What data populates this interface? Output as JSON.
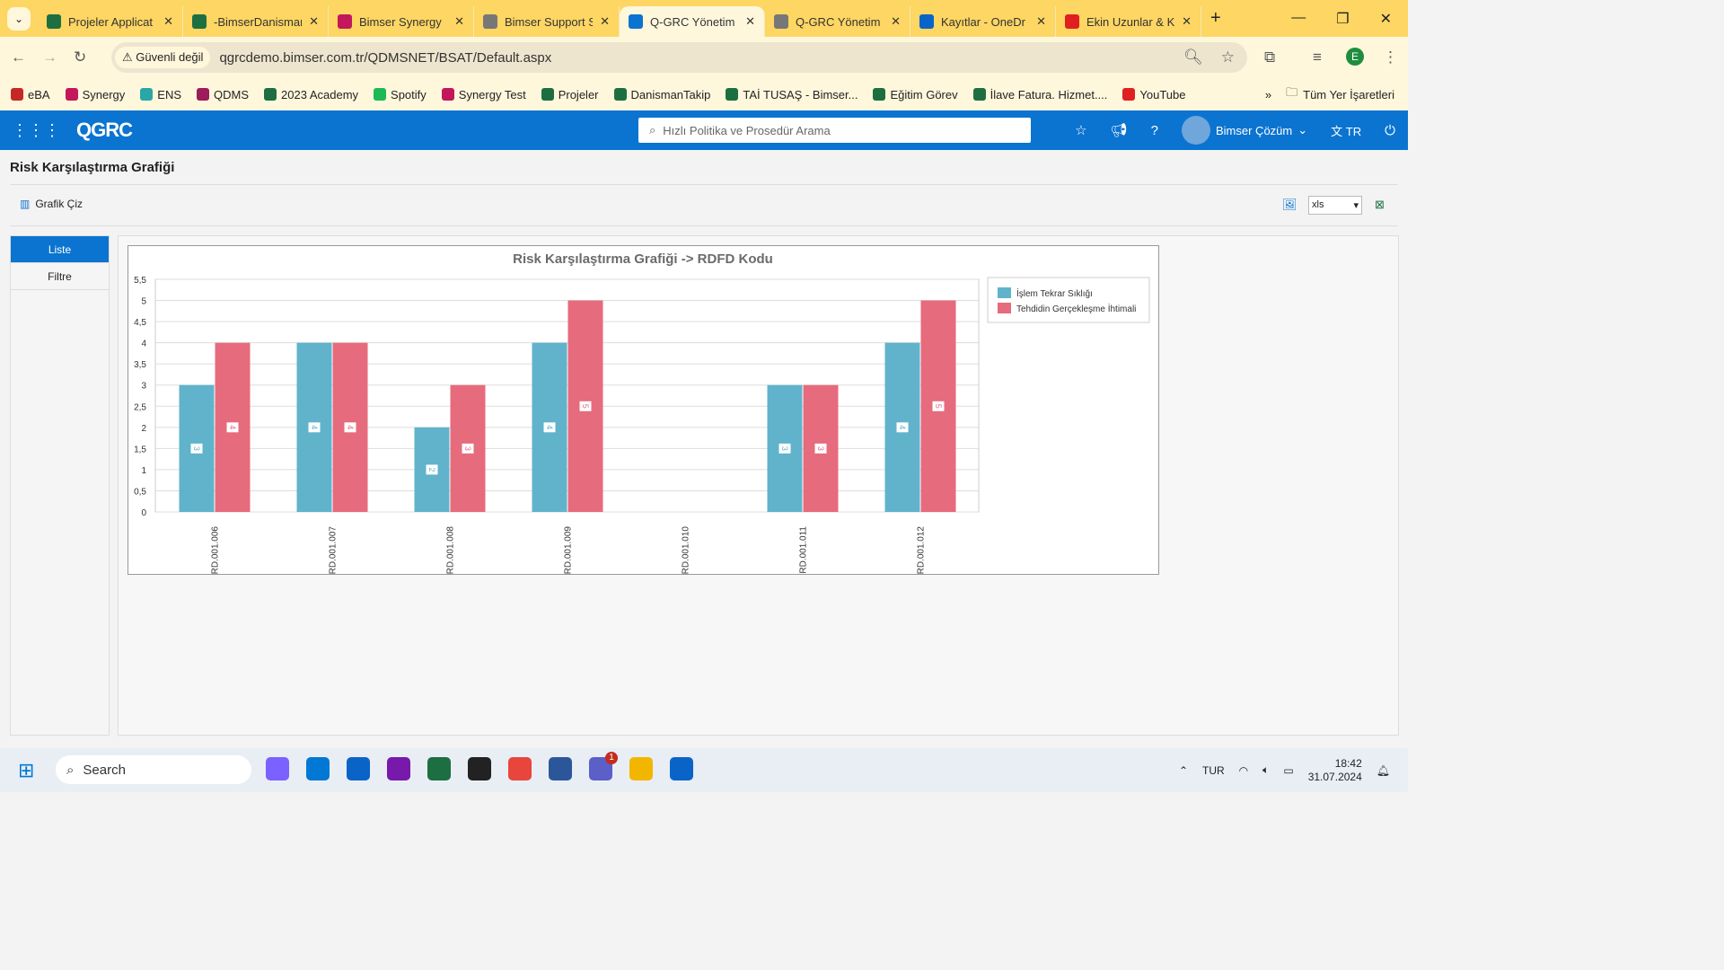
{
  "browser": {
    "tabs": [
      {
        "title": "Projeler Applicat",
        "icon": "excel-icon",
        "color": "#1d6f42"
      },
      {
        "title": "-BimserDanisman",
        "icon": "excel-icon",
        "color": "#1d6f42"
      },
      {
        "title": "Bimser Synergy",
        "icon": "synergy-icon",
        "color": "#c2185b"
      },
      {
        "title": "Bimser Support S",
        "icon": "globe-icon",
        "color": "#777777"
      },
      {
        "title": "Q-GRC Yönetim S",
        "icon": "grc-icon",
        "color": "#0b74d0",
        "active": true
      },
      {
        "title": "Q-GRC Yönetim",
        "icon": "globe-icon",
        "color": "#777777"
      },
      {
        "title": "Kayıtlar - OneDr",
        "icon": "onedrive-icon",
        "color": "#0a64c8"
      },
      {
        "title": "Ekin Uzunlar & K",
        "icon": "youtube-icon",
        "color": "#e02020"
      }
    ],
    "security_label": "Güvenli değil",
    "url": "qgrcdemo.bimser.com.tr/QDMSNET/BSAT/Default.aspx",
    "profile_initial": "E",
    "bookmarks": [
      {
        "label": "eBA",
        "color": "#c62828"
      },
      {
        "label": "Synergy",
        "color": "#c2185b"
      },
      {
        "label": "ENS",
        "color": "#2aa6a6"
      },
      {
        "label": "QDMS",
        "color": "#9c1c5c"
      },
      {
        "label": "2023 Academy",
        "color": "#1d6f42"
      },
      {
        "label": "Spotify",
        "color": "#1db954"
      },
      {
        "label": "Synergy Test",
        "color": "#c2185b"
      },
      {
        "label": "Projeler",
        "color": "#1d6f42"
      },
      {
        "label": "DanismanTakip",
        "color": "#1d6f42"
      },
      {
        "label": "TAİ TUSAŞ - Bimser...",
        "color": "#1d6f42"
      },
      {
        "label": "Eğitim Görev",
        "color": "#1d6f42"
      },
      {
        "label": "İlave Fatura. Hizmet....",
        "color": "#1d6f42"
      },
      {
        "label": "YouTube",
        "color": "#e02020"
      }
    ],
    "all_bookmarks": "Tüm Yer İşaretleri"
  },
  "app": {
    "logo": "QGRC",
    "search_placeholder": "Hızlı Politika ve Prosedür Arama",
    "user": "Bimser Çözüm",
    "lang": "TR",
    "page_title": "Risk Karşılaştırma Grafiği",
    "draw_button": "Grafik Çiz",
    "export_format": "xls",
    "side": [
      "Liste",
      "Filtre"
    ]
  },
  "chart_data": {
    "type": "bar",
    "title": "Risk Karşılaştırma Grafiği -> RDFD Kodu",
    "categories": [
      "RD.001.006",
      "RD.001.007",
      "RD.001.008",
      "RD.001.009",
      "RD.001.010",
      "RD.001.011",
      "RD.001.012"
    ],
    "series": [
      {
        "name": "İşlem Tekrar Sıklığı",
        "color": "#60b3cb",
        "values": [
          3,
          4,
          2,
          4,
          null,
          3,
          4
        ]
      },
      {
        "name": "Tehdidin Gerçekleşme İhtimali",
        "color": "#e66b7c",
        "values": [
          4,
          4,
          3,
          5,
          null,
          3,
          5
        ]
      }
    ],
    "ylim": [
      0,
      5.5
    ],
    "yticks": [
      "0",
      "0,5",
      "1",
      "1,5",
      "2",
      "2,5",
      "3",
      "3,5",
      "4",
      "4,5",
      "5",
      "5,5"
    ],
    "grid": true,
    "legend": "top-right"
  },
  "taskbar": {
    "search": "Search",
    "lang": "TUR",
    "time": "18:42",
    "date": "31.07.2024",
    "teams_badge": "1"
  }
}
